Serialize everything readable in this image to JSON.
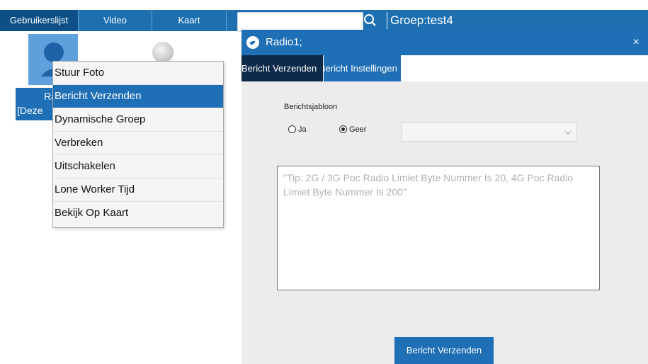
{
  "tabs": [
    {
      "label": "Gebruikerslijst"
    },
    {
      "label": "Video"
    },
    {
      "label": "Kaart"
    }
  ],
  "search": {
    "value": "",
    "placeholder": ""
  },
  "group": {
    "label": "Groep:test4"
  },
  "user": {
    "label_line1": "Rad",
    "label_line2": "[Deze"
  },
  "context_menu": {
    "items": [
      {
        "label": "Stuur Foto"
      },
      {
        "label": "Bericht Verzenden"
      },
      {
        "label": "Dynamische Groep"
      },
      {
        "label": "Verbreken"
      },
      {
        "label": "Uitschakelen"
      },
      {
        "label": "Lone Worker Tijd"
      },
      {
        "label": "Bekijk Op Kaart"
      }
    ]
  },
  "dialog": {
    "title": "Radio1;",
    "close": "×",
    "tabs": [
      {
        "label": "Bericht Verzenden"
      },
      {
        "label": "Bericht Instellingen"
      }
    ],
    "template_label": "Berichtsjabloon",
    "radio_yes": "Ja",
    "radio_no": "Geer",
    "select_value": "",
    "message_placeholder": "\"Tip: 2G / 3G Poc Radio Limiet Byte Nummer Is 20, 4G Poc Radio Limiet Byte Nummer Is 200\"",
    "send_button": "Bericht Verzenden"
  },
  "colors": {
    "primary": "#1e6fb5",
    "dark_tab": "#0d2a4a",
    "dialog_bg": "#ececec"
  }
}
